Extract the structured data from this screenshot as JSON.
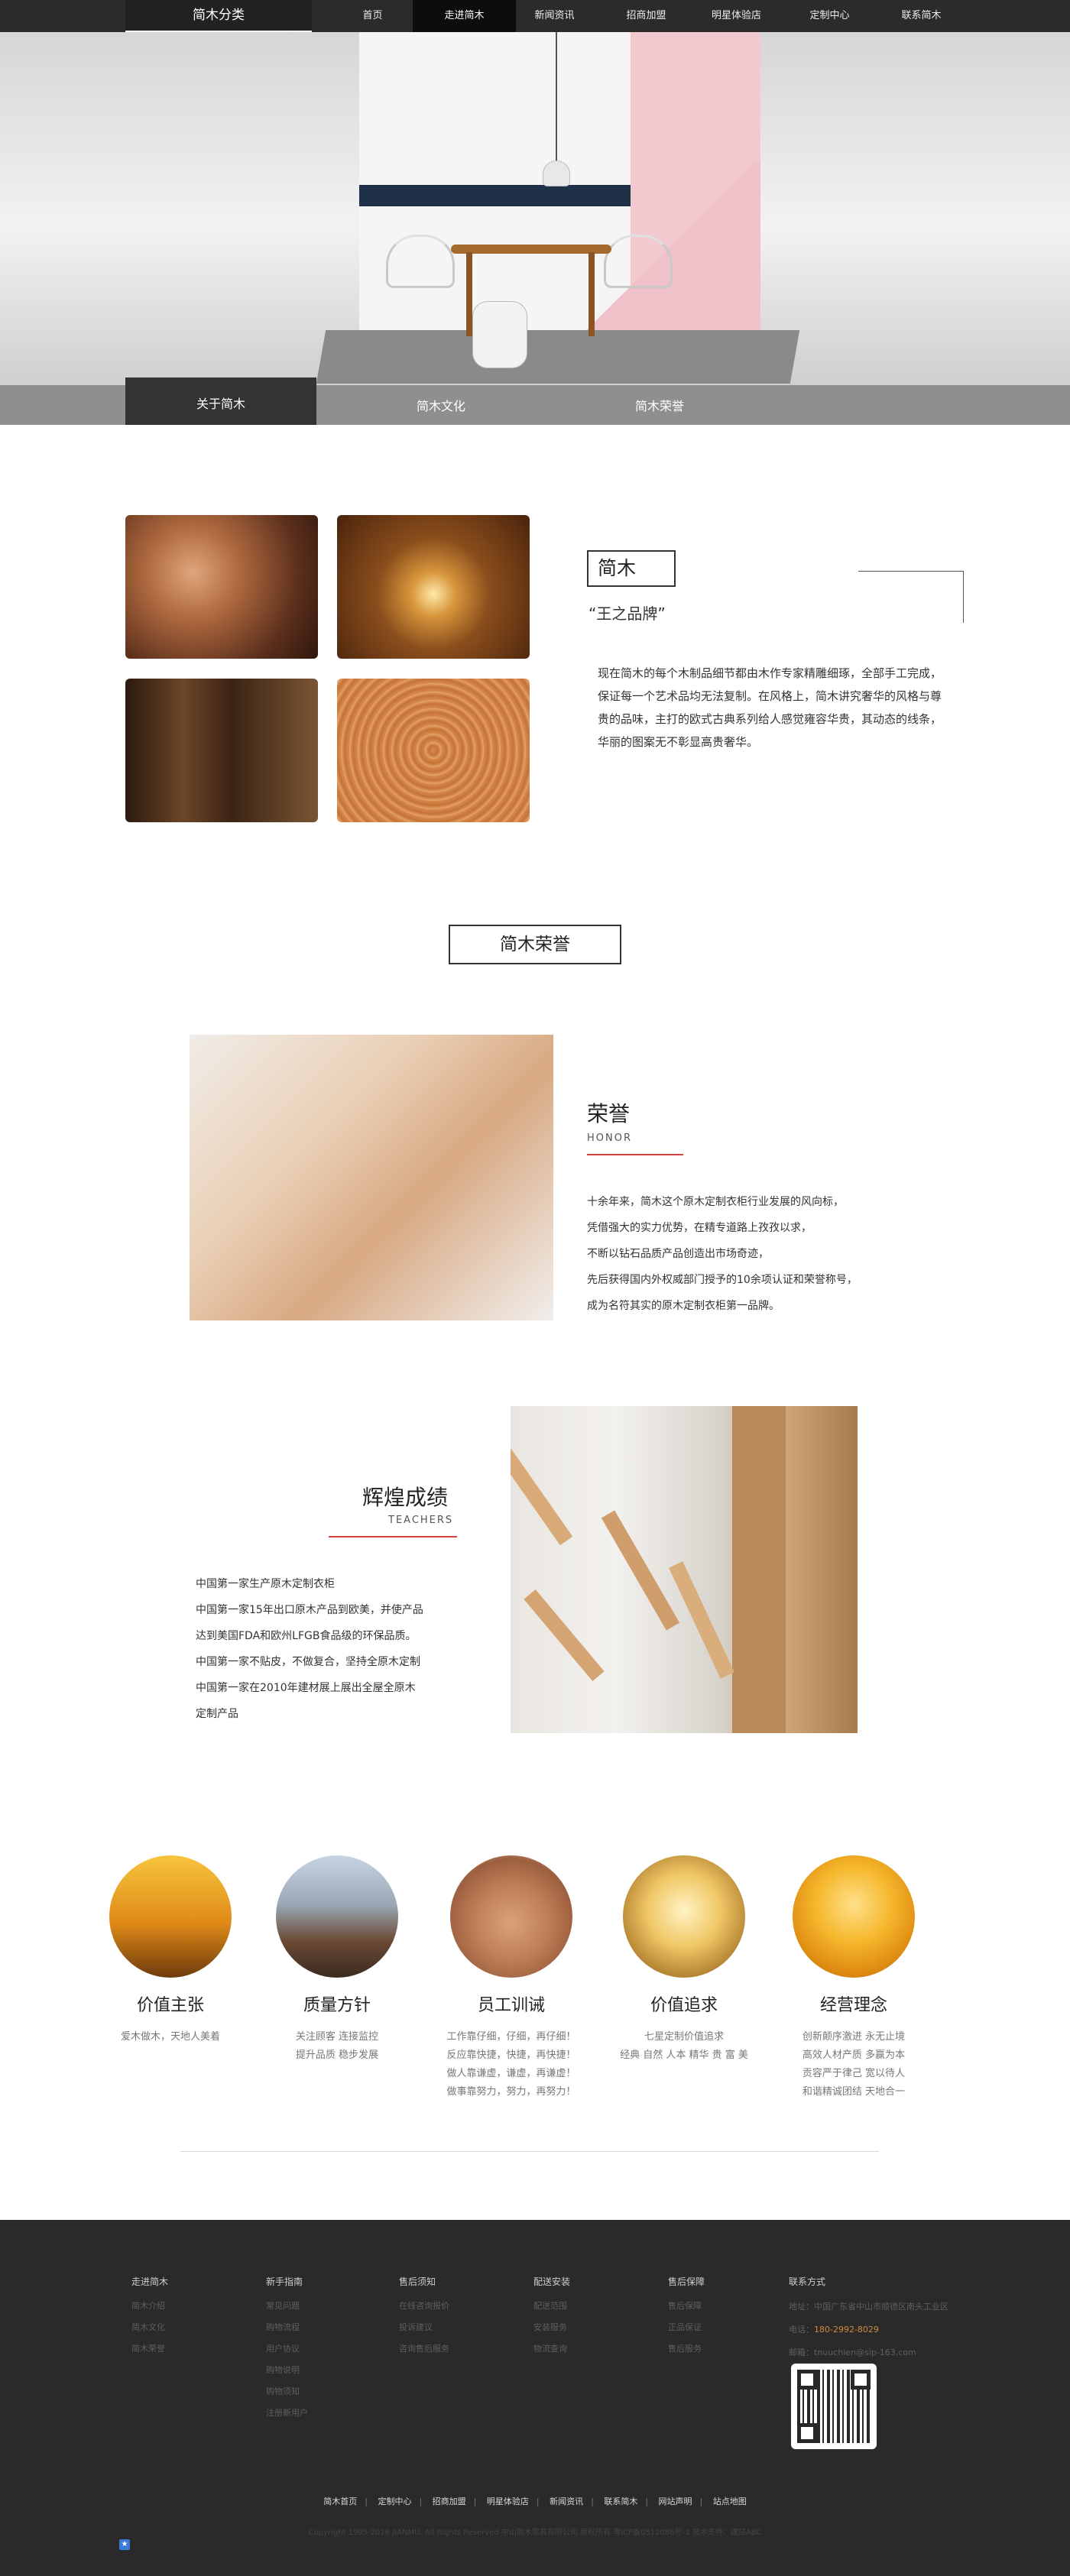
{
  "nav": {
    "logo": "简木分类",
    "items": [
      "首页",
      "走进简木",
      "新闻资讯",
      "招商加盟",
      "明星体验店",
      "定制中心",
      "联系简木"
    ],
    "active": "走进简木"
  },
  "subnav": {
    "items": [
      "关于简木",
      "简木文化",
      "简木荣誉"
    ],
    "active": "关于简木"
  },
  "about": {
    "title": "简木",
    "subtitle": "“王之品牌”",
    "text": "现在简木的每个木制品细节都由木作专家精雕细琢，全部手工完成，保证每一个艺术品均无法复制。在风格上，简木讲究奢华的风格与尊贵的品味，主打的欧式古典系列给人感觉雍容华贵，其动态的线条，华丽的图案无不彰显高贵奢华。"
  },
  "honor_section": {
    "title": "简木荣誉"
  },
  "honor": {
    "title": "荣誉",
    "sub": "HONOR",
    "lines": [
      "十余年来，简木这个原木定制衣柜行业发展的风向标，",
      "凭借强大的实力优势，在精专道路上孜孜以求，",
      "不断以钻石品质产品创造出市场奇迹，",
      "先后获得国内外权威部门授予的10余项认证和荣誉称号，",
      "成为名符其实的原木定制衣柜第一品牌。"
    ]
  },
  "achieve": {
    "title": "辉煌成绩",
    "sub": "TEACHERS",
    "lines": [
      "中国第一家生产原木定制衣柜",
      "中国第一家15年出口原木产品到欧美，并使产品",
      "达到美国FDA和欧州LFGB食品级的环保品质。",
      "中国第一家不贴皮，不做复合，坚持全原木定制",
      "中国第一家在2010年建材展上展出全屋全原木",
      "定制产品"
    ]
  },
  "values": [
    {
      "title": "价值主张",
      "desc": [
        "爱木做木，天地人美着"
      ]
    },
    {
      "title": "质量方针",
      "desc": [
        "关注顾客 连接监控",
        "提升品质 稳步发展"
      ]
    },
    {
      "title": "员工训诫",
      "desc": [
        "工作靠仔细，仔细，再仔细！",
        "反应靠快捷，快捷，再快捷！",
        "做人靠谦虚，谦虚，再谦虚！",
        "做事靠努力，努力，再努力！"
      ]
    },
    {
      "title": "价值追求",
      "desc": [
        "七星定制价值追求",
        "经典 自然 人本 精华 贵 富 美"
      ]
    },
    {
      "title": "经营理念",
      "desc": [
        "创新颠序激进 永无止境",
        "高效人材产质 多赢为本",
        "贡容严于律己 宽以待人",
        "和谐精诚团结 天地合一"
      ]
    }
  ],
  "footer": {
    "columns": [
      {
        "head": "走进简木",
        "links": [
          "简木介绍",
          "简木文化",
          "简木荣誉"
        ]
      },
      {
        "head": "新手指南",
        "links": [
          "常见问题",
          "购物流程",
          "用户协议",
          "购物说明",
          "购物须知",
          "注册新用户"
        ]
      },
      {
        "head": "售后须知",
        "links": [
          "在线咨询报价",
          "投诉建议",
          "咨询售后服务"
        ]
      },
      {
        "head": "配送安装",
        "links": [
          "配送范围",
          "安装服务",
          "物流查询"
        ]
      },
      {
        "head": "售后保障",
        "links": [
          "售后保障",
          "正品保证",
          "售后服务"
        ]
      }
    ],
    "contact": {
      "head": "联系方式",
      "address": "地址：中国广东省中山市顺德区南头工业区",
      "phone_label": "电话：",
      "phone": "180-2992-8029",
      "email": "邮箱：tnuuchien@sip-163.com"
    },
    "bottom_links": [
      "简木首页",
      "定制中心",
      "招商加盟",
      "明星体验店",
      "新闻资讯",
      "联系简木",
      "网站声明",
      "站点地图"
    ],
    "copyright": "Copyright 1995-2016 JIANMU. All Rights Reserved 中山简木家具有限公司 版权所有 粤ICP备0512086号-1 技术支持：建站ABC"
  },
  "colors": {
    "accent_rule": "#d3423e",
    "nav_bg": "#2b2b2b",
    "footer_bg": "#2a2a2a",
    "phone_highlight": "#d08a38"
  }
}
